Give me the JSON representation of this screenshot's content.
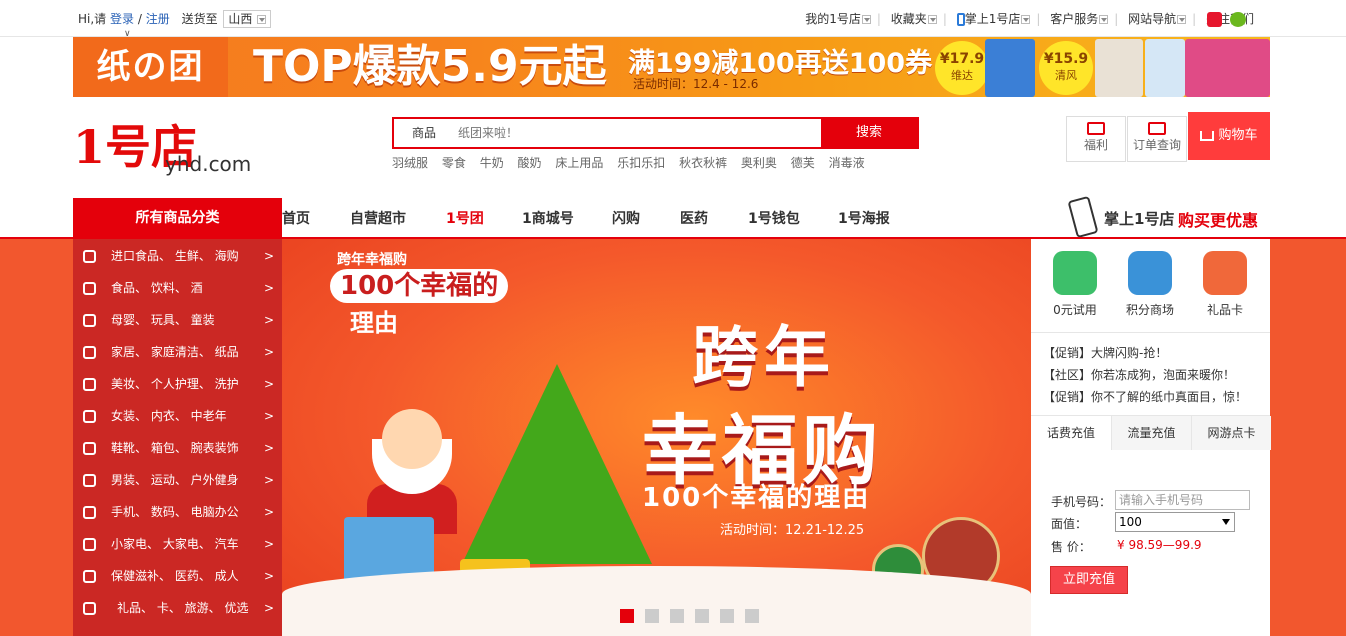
{
  "topbar": {
    "greeting": "Hi,请",
    "login": "登录",
    "slash": "/",
    "register": "注册",
    "ship_to": "送货至",
    "region": "山西",
    "right_items": [
      "我的1号店",
      "收藏夹",
      "掌上1号店",
      "客户服务",
      "网站导航",
      "关注我们"
    ]
  },
  "banner": {
    "brand": "纸の团",
    "headline": "TOP爆款5.9元起",
    "promo": "满199减100再送100券",
    "time": "活动时间：12.4 - 12.6",
    "deals": [
      {
        "price": "¥17.9",
        "name": "维达"
      },
      {
        "price": "¥15.9",
        "name": "清风"
      }
    ]
  },
  "header": {
    "logo_big": "1号店",
    "logo_domain": "yhd.com",
    "search_category": "商品",
    "search_placeholder": "纸团来啦！",
    "search_button": "搜索",
    "hotwords": [
      "羽绒服",
      "零食",
      "牛奶",
      "酸奶",
      "床上用品",
      "乐扣乐扣",
      "秋衣秋裤",
      "奥利奥",
      "德芙",
      "消毒液"
    ],
    "welfare": "福利",
    "order_query": "订单查询",
    "cart": "购物车"
  },
  "nav": {
    "all_categories": "所有商品分类",
    "links": [
      "首页",
      "自营超市",
      "1号团",
      "1商城号",
      "闪购",
      "医药",
      "1号钱包",
      "1号海报"
    ],
    "app_promo_1": "掌上1号店",
    "app_promo_2": "购买更优惠"
  },
  "sidebar": {
    "items": [
      {
        "label": "进口食品、 生鲜、 海购",
        "icon": "tag-icon"
      },
      {
        "label": "食品、 饮料、 酒",
        "icon": "fork-knife-icon"
      },
      {
        "label": "母婴、 玩具、 童装",
        "icon": "baby-icon"
      },
      {
        "label": "家居、 家庭清洁、 纸品",
        "icon": "home-icon"
      },
      {
        "label": "美妆、 个人护理、 洗护",
        "icon": "lipstick-icon"
      },
      {
        "label": "女装、 内衣、 中老年",
        "icon": "dress-icon"
      },
      {
        "label": "鞋靴、 箱包、 腕表装饰",
        "icon": "bag-icon"
      },
      {
        "label": "男装、 运动、 户外健身",
        "icon": "shirt-icon"
      },
      {
        "label": "手机、 数码、 电脑办公",
        "icon": "phone-icon"
      },
      {
        "label": "小家电、 大家电、 汽车",
        "icon": "appliance-icon"
      },
      {
        "label": "保健滋补、 医药、 成人",
        "icon": "pill-icon"
      },
      {
        "label": "礼品、 卡、 旅游、 优选",
        "icon": "card-icon"
      }
    ],
    "arrow": ">"
  },
  "hero": {
    "ribbon_top": "跨年幸福购",
    "ribbon_head": "100个幸福的",
    "ribbon_sub": "理由",
    "title_1": "跨年",
    "title_2": "幸福购",
    "subtitle": "100个幸福的理由",
    "date": "活动时间：12.21-12.25",
    "slides": 6,
    "active_slide": 1
  },
  "right_panel": {
    "services": [
      {
        "label": "0元试用",
        "icon": "gift-icon",
        "color": "#3dbf6a"
      },
      {
        "label": "积分商场",
        "icon": "coins-icon",
        "color": "#3a92d8"
      },
      {
        "label": "礼品卡",
        "icon": "card-icon",
        "color": "#f0683a"
      }
    ],
    "news": [
      "【促销】大牌闪购-抢！",
      "【社区】你若冻成狗，泡面来暖你！",
      "【促销】你不了解的纸巾真面目，惊！"
    ],
    "tabs": [
      "话费充值",
      "流量充值",
      "网游点卡"
    ],
    "phone_label": "手机号码：",
    "phone_placeholder": "请输入手机号码",
    "amount_label": "面值：",
    "amount_value": "100",
    "price_label": "售 价：",
    "price_value": "¥ 98.59—99.9",
    "charge_button": "立即充值"
  },
  "colors": {
    "brand_red": "#e4000b",
    "banner_orange": "#f7821d"
  }
}
